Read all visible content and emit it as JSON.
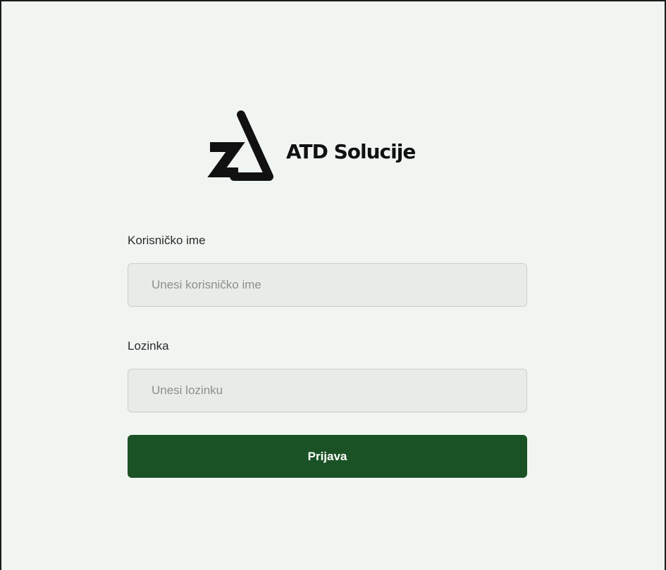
{
  "brand": {
    "name": "ATD Solucije",
    "logo_icon": "atd-logo-mark",
    "logo_color": "#111111"
  },
  "form": {
    "username_label": "Korisničko ime",
    "username_placeholder": "Unesi korisničko ime",
    "username_value": "",
    "password_label": "Lozinka",
    "password_placeholder": "Unesi lozinku",
    "password_value": "",
    "submit_label": "Prijava"
  },
  "colors": {
    "background": "#f1f5f2",
    "input_background": "#e8ece9",
    "button_background": "#1a5225",
    "button_text": "#ffffff"
  }
}
